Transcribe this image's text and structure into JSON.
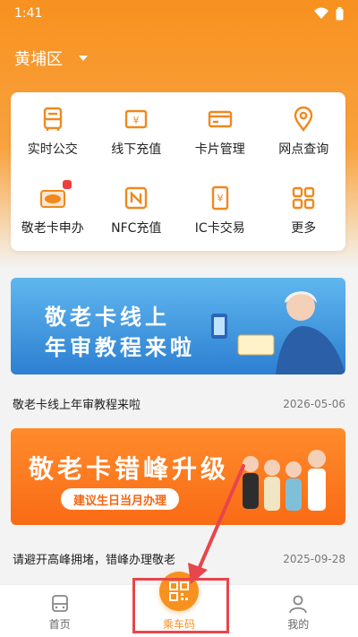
{
  "status_bar": {
    "time": "1:41"
  },
  "header": {
    "district": "黄埔区"
  },
  "services": [
    {
      "id": "bus",
      "label": "实时公交",
      "icon": "bus-icon"
    },
    {
      "id": "recharge",
      "label": "线下充值",
      "icon": "yuan-card-icon"
    },
    {
      "id": "card",
      "label": "卡片管理",
      "icon": "card-icon"
    },
    {
      "id": "location",
      "label": "网点查询",
      "icon": "location-pin-icon"
    },
    {
      "id": "senior",
      "label": "敬老卡申办",
      "icon": "senior-card-icon"
    },
    {
      "id": "nfc",
      "label": "NFC充值",
      "icon": "nfc-icon"
    },
    {
      "id": "ic",
      "label": "IC卡交易",
      "icon": "yuan-phone-icon"
    },
    {
      "id": "more",
      "label": "更多",
      "icon": "grid-icon"
    }
  ],
  "news": [
    {
      "banner_line1": "敬老卡线上",
      "banner_line2": "年审教程来啦",
      "title": "敬老卡线上年审教程来啦",
      "date": "2026-05-06"
    },
    {
      "banner_line1": "敬老卡错峰升级",
      "banner_pill": "建议生日当月办理",
      "title": "请避开高峰拥堵，错峰办理敬老",
      "date": "2025-09-28"
    }
  ],
  "bottom_nav": {
    "home": "首页",
    "ride_code": "乘车码",
    "mine": "我的"
  },
  "colors": {
    "brand": "#f7911f",
    "highlight": "#e8454c"
  }
}
